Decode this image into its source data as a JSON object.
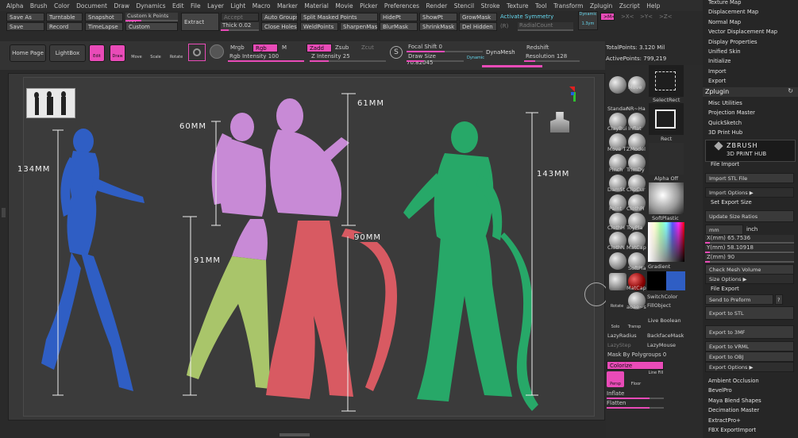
{
  "menu": [
    "Alpha",
    "Brush",
    "Color",
    "Document",
    "Draw",
    "Dynamics",
    "Edit",
    "File",
    "Layer",
    "Light",
    "Macro",
    "Marker",
    "Material",
    "Movie",
    "Picker",
    "Preferences",
    "Render",
    "Stencil",
    "Stroke",
    "Texture",
    "Tool",
    "Transform",
    "Zplugin",
    "Zscript",
    "Help"
  ],
  "top": {
    "save_as": "Save As",
    "turntable": "Turntable",
    "snapshot": "Snapshot",
    "custom_k": "Custom k Points",
    "custom_k_val": "400",
    "save": "Save",
    "record": "Record",
    "timelapse": "TimeLapse",
    "custom": "Custom",
    "extract": "Extract",
    "accept": "Accept",
    "thick": "Thick",
    "thick_val": "0.02",
    "auto_groups": "Auto Groups",
    "close_holes": "Close Holes",
    "split_masked": "Split Masked Points",
    "weld_points": "WeldPoints",
    "sharpen_mask": "SharpenMask",
    "hide_pt": "HidePt",
    "blur_mask": "BlurMask",
    "show_pt": "ShowPt",
    "shrink_mask": "ShrinkMask",
    "grow_mask": "GrowMask",
    "del_hidden": "Del Hidden",
    "activate_symmetry": "Activate Symmetry",
    "r_label": "(R)",
    "radial_count": "RadialCount",
    "dynamic": "Dynamic",
    "persp": "1.3ym",
    "x_sym": ">X<",
    "y_sym": ">Y<",
    "z_sym": ">Z<",
    "m_sym": ">M<"
  },
  "tools": {
    "home_page": "Home Page",
    "lightbox": "LightBox",
    "edit": "Edit",
    "draw": "Draw",
    "move": "Move",
    "scale": "Scale",
    "rotate": "Rotate",
    "mrgb": "Mrgb",
    "rgb": "Rgb",
    "m": "M",
    "rgb_intensity": "Rgb Intensity",
    "rgb_intensity_val": "100",
    "zadd": "Zadd",
    "zsub": "Zsub",
    "zcut": "Zcut",
    "z_intensity": "Z Intensity",
    "z_intensity_val": "25",
    "focal_shift": "Focal Shift",
    "focal_shift_val": "0",
    "draw_size": "Draw Size",
    "draw_size_val": "70.82045",
    "dynamic": "Dynamic",
    "dynamesh": "DynaMesh",
    "redshift": "Redshift",
    "resolution": "Resolution",
    "resolution_val": "128",
    "total_points": "TotalPoints: 3.120 Mil",
    "active_points": "ActivePoints: 799,219"
  },
  "measurements": {
    "blue": "134MM",
    "top_left": "60MM",
    "top_right": "61MM",
    "green": "143MM",
    "mid_left": "91MM",
    "mid_right": "90MM"
  },
  "brushes": {
    "standard": "Standar",
    "nr_hatch": "NR~Ha",
    "claybuildup": "ClayBui",
    "inflat": "Inflat",
    "move_t": "Move T",
    "zmodel": "ZModel",
    "pinch": "Pinch",
    "trimdy": "TrimDy",
    "damstd": "DamSt",
    "clipcur": "ClipCur",
    "paint": "Paint",
    "clothpu": "ClothPi",
    "clothh": "ClothH",
    "toyplas": "ToyPla",
    "clothn": "ClothN",
    "matcap": "MatCap",
    "softp": "SoftPla",
    "move": "Move",
    "select_rect": "SelectRect",
    "rect": "Rect",
    "alpha_off": "Alpha Off",
    "soft_plastic": "SoftPlastic",
    "gradient": "Gradient",
    "switch_color": "SwitchColor",
    "fill_object": "FillObject",
    "live_boolean": "Live Boolean",
    "backface_mask": "BackfaceMask",
    "lazy_mouse": "LazyMouse",
    "lazy_radius": "LazyRadius",
    "lazy_step": "LazyStep",
    "mask_by_polygroups": "Mask By Polygroups",
    "mask_by_polygroups_val": "0",
    "colorize": "Colorize",
    "inflate": "Inflate",
    "flatten": "Flatten",
    "solo": "Solo",
    "transp": "Transp",
    "rotate": "Rotate",
    "persp": "Persp",
    "floor": "Floor",
    "line_fill": "Line Fill",
    "matcap2": "MatCap",
    "adobe": "aoae~s",
    "brush_alpha": "BrushZ"
  },
  "right_panel": {
    "top_items": [
      "Texture Map",
      "Displacement Map",
      "Normal Map",
      "Vector Displacement Map",
      "Display Properties",
      "Unified Skin",
      "Initialize",
      "Import",
      "Export"
    ],
    "zplugin": "Zplugin",
    "zp_items": [
      "Misc Utilities",
      "Projection Master",
      "QuickSketch",
      "3D Print Hub"
    ],
    "hub_title1": "ZBRUSH",
    "hub_title2": "3D PRINT HUB",
    "file_import": "File Import",
    "import_stl": "Import STL File",
    "import_options": "Import Options ▶",
    "set_export_size": "Set Export Size",
    "update_size_ratios": "Update Size Ratios",
    "mm": "mm",
    "inch": "inch",
    "x_mm": "X(mm) 65.7536",
    "y_mm": "Y(mm) 58.10918",
    "z_mm": "Z(mm) 90",
    "check_mesh_volume": "Check Mesh Volume",
    "size_options": "Size Options ▶",
    "file_export": "File Export",
    "send_to_preform": "Send to Preform",
    "help_q": "?",
    "export_stl": "Export to STL",
    "export_3mf": "Export to 3MF",
    "export_vrml": "Export to VRML",
    "export_obj": "Export to OBJ",
    "export_options": "Export Options ▶",
    "bottom_items": [
      "Ambient Occlusion",
      "BevelPro",
      "Maya Blend Shapes",
      "Decimation Master",
      "ExtractPro+",
      "FBX ExportImport"
    ]
  },
  "colors": {
    "accent": "#e94bb8",
    "blue_figure": "#2f5ec4",
    "pink_figure": "#c88ad6",
    "green_leg_figure": "#a9c56a",
    "red_figure": "#d85a62",
    "green_figure": "#27a868"
  }
}
